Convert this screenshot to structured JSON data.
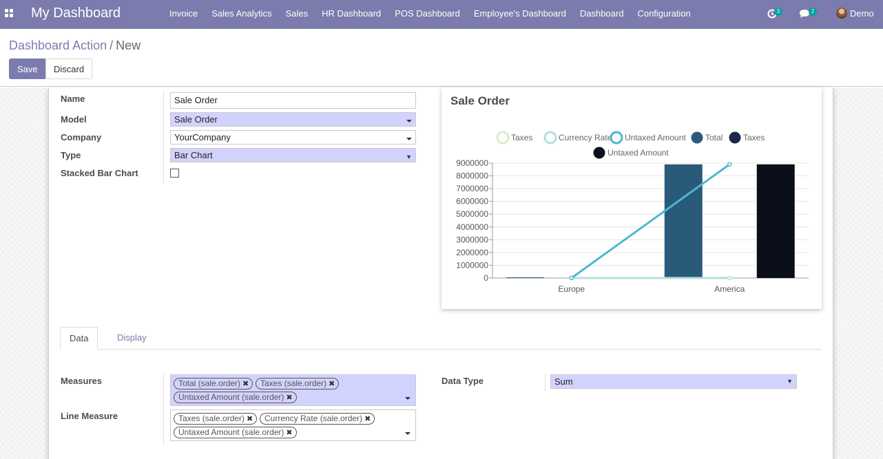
{
  "navbar": {
    "brand": "My Dashboard",
    "menu": [
      "Invoice",
      "Sales Analytics",
      "Sales",
      "HR Dashboard",
      "POS Dashboard",
      "Employee's Dashboard",
      "Dashboard",
      "Configuration"
    ],
    "activity_count": "3",
    "messages_count": "2",
    "user": "Demo",
    "colors": {
      "bar": "#7c7bad",
      "badge": "#00a09d"
    }
  },
  "breadcrumb": {
    "parent": "Dashboard Action",
    "separator": "/",
    "current": "New"
  },
  "buttons": {
    "save": "Save",
    "discard": "Discard"
  },
  "form": {
    "name": {
      "label": "Name",
      "value": "Sale Order"
    },
    "model": {
      "label": "Model",
      "value": "Sale Order"
    },
    "company": {
      "label": "Company",
      "value": "YourCompany"
    },
    "type": {
      "label": "Type",
      "value": "Bar Chart"
    },
    "stacked": {
      "label": "Stacked Bar Chart",
      "checked": false
    }
  },
  "chart_data": {
    "type": "bar",
    "title": "Sale Order",
    "categories": [
      "Europe",
      "America"
    ],
    "ylim": [
      0,
      9000000
    ],
    "yticks": [
      "0",
      "1000000",
      "2000000",
      "3000000",
      "4000000",
      "5000000",
      "6000000",
      "7000000",
      "8000000",
      "9000000"
    ],
    "grid": true,
    "legend_position": "top",
    "series": [
      {
        "name": "Total",
        "kind": "bar",
        "values": [
          5000,
          8900000
        ],
        "color": "#2a5a7a"
      },
      {
        "name": "Taxes",
        "kind": "bar",
        "values": [
          0,
          0
        ],
        "color": "#1a2a4a"
      },
      {
        "name": "Untaxed Amount",
        "kind": "bar",
        "values": [
          5000,
          8900000
        ],
        "color": "#0a0f1a"
      }
    ],
    "lines": [
      {
        "name": "Taxes",
        "values": [
          0,
          0
        ],
        "color": "#dcedc8"
      },
      {
        "name": "Currency Rate",
        "values": [
          1,
          1
        ],
        "color": "#b2dfdb"
      },
      {
        "name": "Untaxed Amount",
        "values": [
          5000,
          8900000
        ],
        "color": "#4db6d2"
      }
    ]
  },
  "tabs": [
    "Data",
    "Display"
  ],
  "data_tab": {
    "measures": {
      "label": "Measures",
      "tags": [
        "Total (sale.order)",
        "Taxes (sale.order)",
        "Untaxed Amount (sale.order)"
      ]
    },
    "line_measure": {
      "label": "Line Measure",
      "tags": [
        "Taxes (sale.order)",
        "Currency Rate (sale.order)",
        "Untaxed Amount (sale.order)"
      ]
    },
    "data_type": {
      "label": "Data Type",
      "value": "Sum"
    }
  }
}
